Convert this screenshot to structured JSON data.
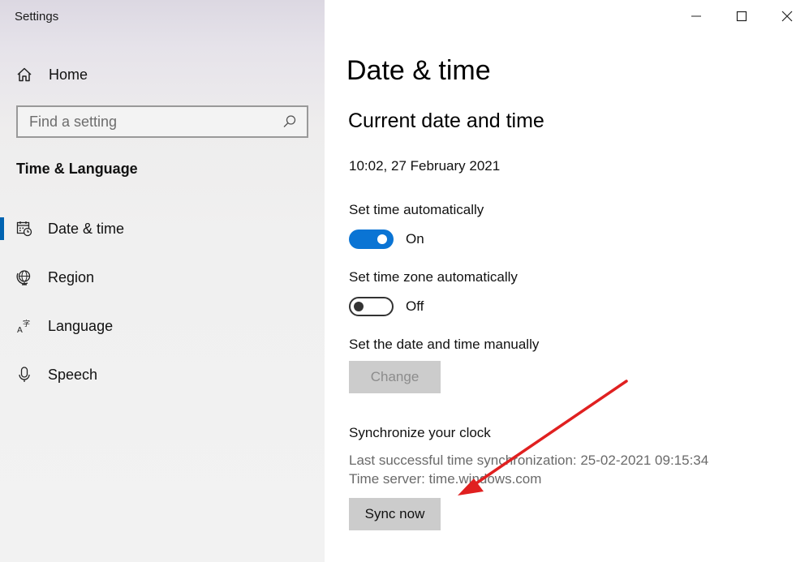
{
  "window": {
    "title": "Settings",
    "controls": {
      "minimize": "minimize-icon",
      "maximize": "maximize-icon",
      "close": "close-icon"
    }
  },
  "sidebar": {
    "home_label": "Home",
    "home_icon": "home-icon",
    "search": {
      "placeholder": "Find a setting",
      "value": "",
      "icon": "search-icon"
    },
    "section_title": "Time & Language",
    "items": [
      {
        "label": "Date & time",
        "icon": "calendar-clock-icon",
        "selected": true
      },
      {
        "label": "Region",
        "icon": "globe-icon",
        "selected": false
      },
      {
        "label": "Language",
        "icon": "language-icon",
        "selected": false
      },
      {
        "label": "Speech",
        "icon": "microphone-icon",
        "selected": false
      }
    ],
    "accent_color": "#0063b1"
  },
  "main": {
    "page_title": "Date & time",
    "section_title": "Current date and time",
    "current_datetime": "10:02, 27 February 2021",
    "set_time_auto": {
      "label": "Set time automatically",
      "state": "On",
      "enabled": true
    },
    "set_timezone_auto": {
      "label": "Set time zone automatically",
      "state": "Off",
      "enabled": false
    },
    "manual": {
      "label": "Set the date and time manually",
      "button": "Change",
      "button_disabled": true
    },
    "sync": {
      "title": "Synchronize your clock",
      "last_sync": "Last successful time synchronization: 25-02-2021 09:15:34",
      "time_server": "Time server: time.windows.com",
      "button": "Sync now"
    },
    "toggle_on_color": "#0a74d4"
  },
  "annotation": {
    "type": "arrow",
    "color": "#e02020",
    "points_to": "sync-now-button"
  }
}
